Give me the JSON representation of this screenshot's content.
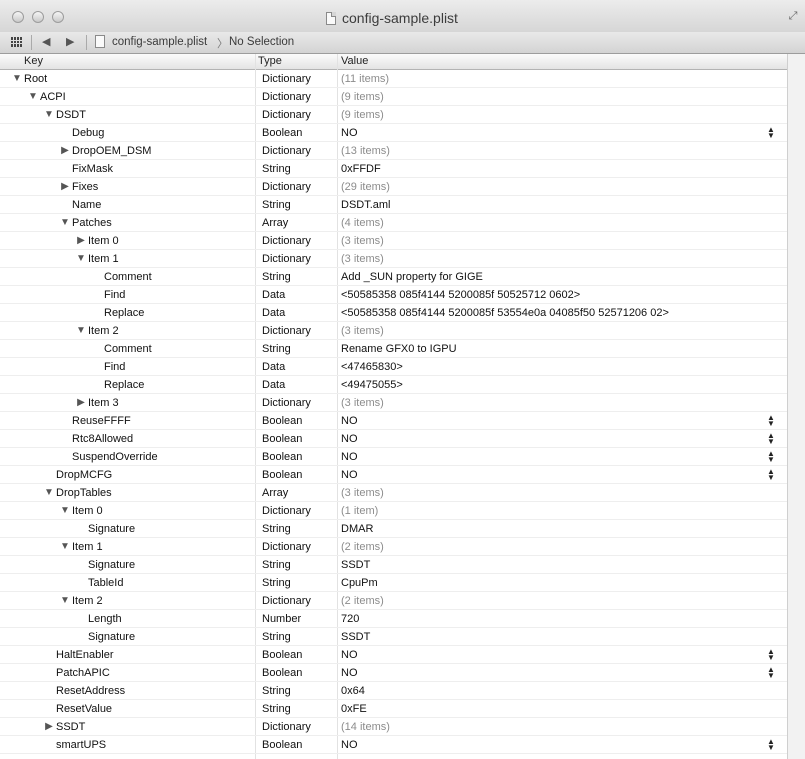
{
  "window": {
    "title": "config-sample.plist"
  },
  "navbar": {
    "crumb_file": "config-sample.plist",
    "crumb_selection": "No Selection",
    "crumb_separator": "〉"
  },
  "columns": {
    "key": "Key",
    "type": "Type",
    "value": "Value"
  },
  "rows": [
    {
      "key": "Root",
      "type": "Dictionary",
      "value": "(11 items)",
      "depth": 0,
      "toggle": "expanded",
      "dim": true,
      "stepper": false
    },
    {
      "key": "ACPI",
      "type": "Dictionary",
      "value": "(9 items)",
      "depth": 1,
      "toggle": "expanded",
      "dim": true,
      "stepper": false
    },
    {
      "key": "DSDT",
      "type": "Dictionary",
      "value": "(9 items)",
      "depth": 2,
      "toggle": "expanded",
      "dim": true,
      "stepper": false
    },
    {
      "key": "Debug",
      "type": "Boolean",
      "value": "NO",
      "depth": 3,
      "toggle": "none",
      "dim": false,
      "stepper": true
    },
    {
      "key": "DropOEM_DSM",
      "type": "Dictionary",
      "value": "(13 items)",
      "depth": 3,
      "toggle": "collapsed",
      "dim": true,
      "stepper": false
    },
    {
      "key": "FixMask",
      "type": "String",
      "value": "0xFFDF",
      "depth": 3,
      "toggle": "none",
      "dim": false,
      "stepper": false
    },
    {
      "key": "Fixes",
      "type": "Dictionary",
      "value": "(29 items)",
      "depth": 3,
      "toggle": "collapsed",
      "dim": true,
      "stepper": false
    },
    {
      "key": "Name",
      "type": "String",
      "value": "DSDT.aml",
      "depth": 3,
      "toggle": "none",
      "dim": false,
      "stepper": false
    },
    {
      "key": "Patches",
      "type": "Array",
      "value": "(4 items)",
      "depth": 3,
      "toggle": "expanded",
      "dim": true,
      "stepper": false
    },
    {
      "key": "Item 0",
      "type": "Dictionary",
      "value": "(3 items)",
      "depth": 4,
      "toggle": "collapsed",
      "dim": true,
      "stepper": false
    },
    {
      "key": "Item 1",
      "type": "Dictionary",
      "value": "(3 items)",
      "depth": 4,
      "toggle": "expanded",
      "dim": true,
      "stepper": false
    },
    {
      "key": "Comment",
      "type": "String",
      "value": "Add _SUN property for GIGE",
      "depth": 5,
      "toggle": "none",
      "dim": false,
      "stepper": false
    },
    {
      "key": "Find",
      "type": "Data",
      "value": "<50585358 085f4144 5200085f 50525712 0602>",
      "depth": 5,
      "toggle": "none",
      "dim": false,
      "stepper": false
    },
    {
      "key": "Replace",
      "type": "Data",
      "value": "<50585358 085f4144 5200085f 53554e0a 04085f50 52571206 02>",
      "depth": 5,
      "toggle": "none",
      "dim": false,
      "stepper": false
    },
    {
      "key": "Item 2",
      "type": "Dictionary",
      "value": "(3 items)",
      "depth": 4,
      "toggle": "expanded",
      "dim": true,
      "stepper": false
    },
    {
      "key": "Comment",
      "type": "String",
      "value": "Rename GFX0 to IGPU",
      "depth": 5,
      "toggle": "none",
      "dim": false,
      "stepper": false
    },
    {
      "key": "Find",
      "type": "Data",
      "value": "<47465830>",
      "depth": 5,
      "toggle": "none",
      "dim": false,
      "stepper": false
    },
    {
      "key": "Replace",
      "type": "Data",
      "value": "<49475055>",
      "depth": 5,
      "toggle": "none",
      "dim": false,
      "stepper": false
    },
    {
      "key": "Item 3",
      "type": "Dictionary",
      "value": "(3 items)",
      "depth": 4,
      "toggle": "collapsed",
      "dim": true,
      "stepper": false
    },
    {
      "key": "ReuseFFFF",
      "type": "Boolean",
      "value": "NO",
      "depth": 3,
      "toggle": "none",
      "dim": false,
      "stepper": true
    },
    {
      "key": "Rtc8Allowed",
      "type": "Boolean",
      "value": "NO",
      "depth": 3,
      "toggle": "none",
      "dim": false,
      "stepper": true
    },
    {
      "key": "SuspendOverride",
      "type": "Boolean",
      "value": "NO",
      "depth": 3,
      "toggle": "none",
      "dim": false,
      "stepper": true
    },
    {
      "key": "DropMCFG",
      "type": "Boolean",
      "value": "NO",
      "depth": 2,
      "toggle": "none",
      "dim": false,
      "stepper": true
    },
    {
      "key": "DropTables",
      "type": "Array",
      "value": "(3 items)",
      "depth": 2,
      "toggle": "expanded",
      "dim": true,
      "stepper": false
    },
    {
      "key": "Item 0",
      "type": "Dictionary",
      "value": "(1 item)",
      "depth": 3,
      "toggle": "expanded",
      "dim": true,
      "stepper": false
    },
    {
      "key": "Signature",
      "type": "String",
      "value": "DMAR",
      "depth": 4,
      "toggle": "none",
      "dim": false,
      "stepper": false
    },
    {
      "key": "Item 1",
      "type": "Dictionary",
      "value": "(2 items)",
      "depth": 3,
      "toggle": "expanded",
      "dim": true,
      "stepper": false
    },
    {
      "key": "Signature",
      "type": "String",
      "value": "SSDT",
      "depth": 4,
      "toggle": "none",
      "dim": false,
      "stepper": false
    },
    {
      "key": "TableId",
      "type": "String",
      "value": "CpuPm",
      "depth": 4,
      "toggle": "none",
      "dim": false,
      "stepper": false
    },
    {
      "key": "Item 2",
      "type": "Dictionary",
      "value": "(2 items)",
      "depth": 3,
      "toggle": "expanded",
      "dim": true,
      "stepper": false
    },
    {
      "key": "Length",
      "type": "Number",
      "value": "720",
      "depth": 4,
      "toggle": "none",
      "dim": false,
      "stepper": false
    },
    {
      "key": "Signature",
      "type": "String",
      "value": "SSDT",
      "depth": 4,
      "toggle": "none",
      "dim": false,
      "stepper": false
    },
    {
      "key": "HaltEnabler",
      "type": "Boolean",
      "value": "NO",
      "depth": 2,
      "toggle": "none",
      "dim": false,
      "stepper": true
    },
    {
      "key": "PatchAPIC",
      "type": "Boolean",
      "value": "NO",
      "depth": 2,
      "toggle": "none",
      "dim": false,
      "stepper": true
    },
    {
      "key": "ResetAddress",
      "type": "String",
      "value": "0x64",
      "depth": 2,
      "toggle": "none",
      "dim": false,
      "stepper": false
    },
    {
      "key": "ResetValue",
      "type": "String",
      "value": "0xFE",
      "depth": 2,
      "toggle": "none",
      "dim": false,
      "stepper": false
    },
    {
      "key": "SSDT",
      "type": "Dictionary",
      "value": "(14 items)",
      "depth": 2,
      "toggle": "collapsed",
      "dim": true,
      "stepper": false
    },
    {
      "key": "smartUPS",
      "type": "Boolean",
      "value": "NO",
      "depth": 2,
      "toggle": "none",
      "dim": false,
      "stepper": true
    }
  ]
}
